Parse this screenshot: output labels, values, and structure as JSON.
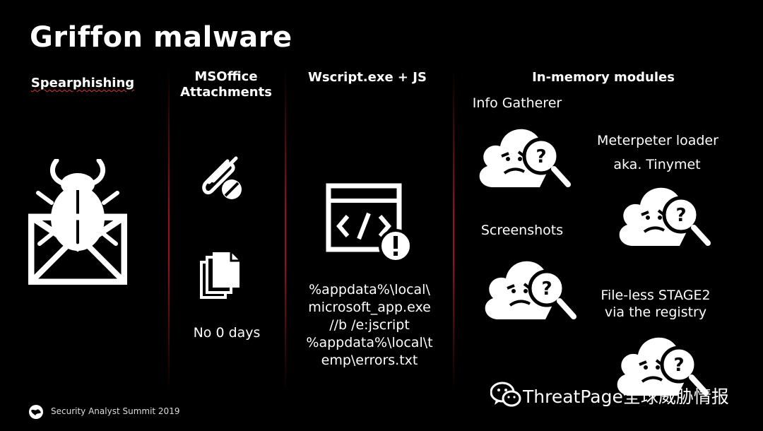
{
  "slide": {
    "title": "Griffon malware",
    "columns": [
      {
        "heading": "Spearphishing"
      },
      {
        "heading": "MSOffice Attachments",
        "caption": "No 0 days"
      },
      {
        "heading": "Wscript.exe + JS",
        "command_lines": [
          "%appdata%\\local\\",
          "microsoft_app.exe",
          "//b /e:jscript",
          "%appdata%\\local\\t",
          "emp\\errors.txt"
        ]
      },
      {
        "heading": "In-memory modules",
        "modules": [
          "Info Gatherer",
          "Meterpeter loader",
          "aka. Tinymet",
          "Screenshots",
          "File-less STAGE2",
          "via the registry"
        ]
      }
    ],
    "footer": "Security Analyst Summit 2019",
    "watermark": "ThreatPage全球威胁情报"
  },
  "colors": {
    "background": "#000000",
    "divider": "#a50d0d",
    "text": "#ffffff"
  },
  "icons": [
    "bug-envelope-icon",
    "paperclip-icon",
    "documents-icon",
    "script-warning-icon",
    "ghost-magnifier-icon",
    "globe-icon",
    "wechat-icon"
  ]
}
